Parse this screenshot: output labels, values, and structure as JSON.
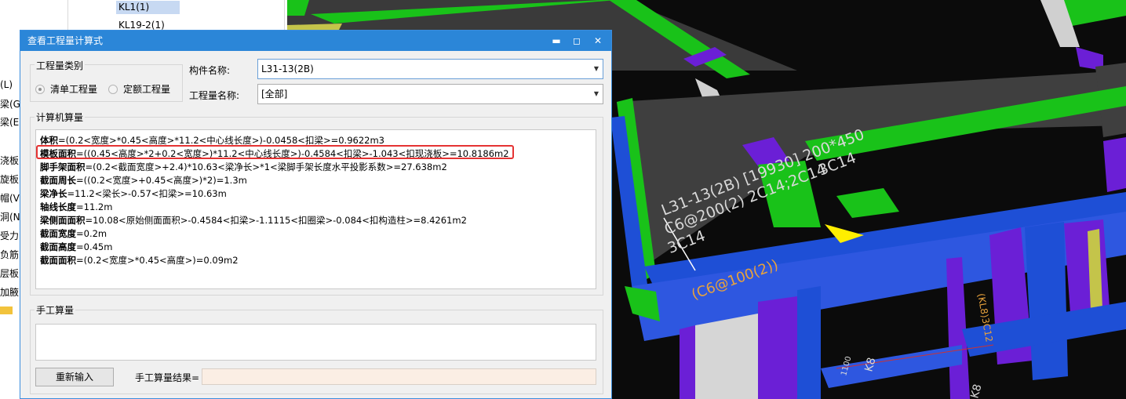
{
  "tree": {
    "items": [
      {
        "label": "KL1(1)",
        "selected": true
      },
      {
        "label": "KL19-2(1)",
        "selected": false
      }
    ],
    "side_labels": [
      "(L)",
      "梁(G",
      "梁(E)",
      "浇板",
      "旋板",
      "帽(V)",
      "洞(N",
      "受力",
      "负筋",
      "层板",
      "加腋"
    ]
  },
  "dialog": {
    "title": "查看工程量计算式",
    "minimize_glyph": "▬",
    "maximize_glyph": "◻",
    "close_glyph": "✕",
    "quantity_type": {
      "group_label": "工程量类别",
      "options": [
        {
          "label": "清单工程量",
          "selected": true
        },
        {
          "label": "定额工程量",
          "selected": false
        }
      ]
    },
    "component_name": {
      "label": "构件名称:",
      "value": "L31-13(2B)"
    },
    "quantity_name": {
      "label": "工程量名称:",
      "value": "[全部]"
    },
    "calc_group_label": "计算机算量",
    "calc_lines": [
      {
        "name": "体积",
        "formula": "=(0.2<宽度>*0.45<高度>*11.2<中心线长度>)-0.0458<扣梁>=0.9622m3"
      },
      {
        "name": "模板面积",
        "formula": "=((0.45<高度>*2+0.2<宽度>)*11.2<中心线长度>)-0.4584<扣梁>-1.043<扣现浇板>=10.8186m2"
      },
      {
        "name": "脚手架面积",
        "formula": "=(0.2<截面宽度>+2.4)*10.63<梁净长>*1<梁脚手架长度水平投影系数>=27.638m2"
      },
      {
        "name": "截面周长",
        "formula": "=((0.2<宽度>+0.45<高度>)*2)=1.3m"
      },
      {
        "name": "梁净长",
        "formula": "=11.2<梁长>-0.57<扣梁>=10.63m"
      },
      {
        "name": "轴线长度",
        "formula": "=11.2m"
      },
      {
        "name": "梁侧面面积",
        "formula": "=10.08<原始侧面面积>-0.4584<扣梁>-1.1115<扣圈梁>-0.084<扣构造柱>=8.4261m2"
      },
      {
        "name": "截面宽度",
        "formula": "=0.2m"
      },
      {
        "name": "截面高度",
        "formula": "=0.45m"
      },
      {
        "name": "截面面积",
        "formula": "=(0.2<宽度>*0.45<高度>)=0.09m2"
      }
    ],
    "manual_group_label": "手工算量",
    "reenter_label": "重新输入",
    "manual_result_label": "手工算量结果=",
    "manual_result_value": ""
  },
  "viewport": {
    "beam_label": "L31-13(2B) [19930] 200*450",
    "rebar_line1": "C6@200(2) 2C14;2C14",
    "rebar_line2": "3C14",
    "rebar_line3": "3C14",
    "stirrup_label": "(C6@100(2))",
    "side_label": "(KL8)3C12",
    "k8_label_1": "K8",
    "k8_label_2": "K8",
    "dim_label": "1100",
    "colors": {
      "slab": "#3f3f3f",
      "beam_green": "#19c219",
      "beam_blue": "#1e4fd6",
      "column_purple": "#6b1fd6",
      "marker_yellow": "#ffee00",
      "stirrup_text": "#e8a23c"
    }
  }
}
